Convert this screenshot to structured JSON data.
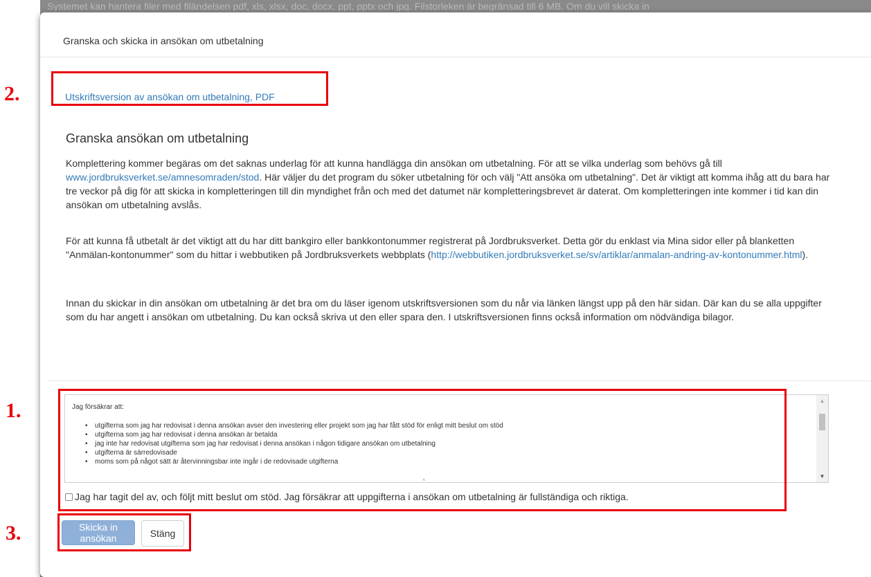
{
  "background": {
    "text": "Systemet kan hantera filer med filändelsen pdf, xls, xlsx, doc, docx, ppt, pptx och jpg. Filstorleken är begränsad till 6 MB. Om du vill skicka in"
  },
  "modal": {
    "title": "Granska och skicka in ansökan om utbetalning",
    "pdf_link": "Utskriftsversion av ansökan om utbetalning, PDF",
    "section_title": "Granska ansökan om utbetalning",
    "p1_a": "Komplettering kommer begäras om det saknas underlag för att kunna handlägga din ansökan om utbetalning. För att se vilka underlag som behövs gå till ",
    "p1_link": "www.jordbruksverket.se/amnesomraden/stod",
    "p1_b": ". Här väljer du det program du söker utbetalning för och välj \"Att ansöka om utbetalning\". Det är viktigt att komma ihåg att du bara har tre veckor på dig för att skicka in kompletteringen till din myndighet från och med det datumet när kompletteringsbrevet är daterat. Om kompletteringen inte kommer i tid kan din ansökan om utbetalning avslås.",
    "p2_a": "För att kunna få utbetalt är det viktigt att du har ditt bankgiro eller bankkontonummer registrerat på Jordbruksverket. Detta gör du enklast via Mina sidor eller på blanketten \"Anmälan-kontonummer\" som du hittar i webbutiken på Jordbruksverkets webbplats (",
    "p2_link": "http://webbutiken.jordbruksverket.se/sv/artiklar/anmalan-andring-av-kontonummer.html",
    "p2_b": ").",
    "p3": "Innan du skickar in din ansökan om utbetalning är det bra om du läser igenom utskriftsversionen som du når via länken längst upp på den här sidan. Där kan du se alla uppgifter som du har angett i ansökan om utbetalning. Du kan också skriva ut den eller spara den. I utskriftsversionen finns också information om nödvändiga bilagor.",
    "declaration": {
      "intro": "Jag försäkrar att:",
      "items": [
        "utgifterna som jag har redovisat i denna ansökan avser den investering eller projekt som jag har fått stöd för enligt mitt beslut om stöd",
        "utgifterna som jag har redovisat i denna ansökan är betalda",
        "jag inte har redovisat utgifterna som jag har redovisat i denna ansökan i någon tidigare ansökan om utbetalning",
        "utgifterna är särredovisade",
        "moms som på något sätt är återvinningsbar inte ingår i de redovisade utgifterna"
      ]
    },
    "checkbox_label": "Jag har tagit del av, och följt mitt beslut om stöd. Jag försäkrar att uppgifterna i ansökan om utbetalning är fullständiga och riktiga.",
    "checkbox_checked": false,
    "submit_label": "Skicka in ansökan",
    "close_label": "Stäng"
  },
  "annotations": {
    "label_1": "1.",
    "label_2": "2.",
    "label_3": "3.",
    "color": "#e8000b"
  }
}
